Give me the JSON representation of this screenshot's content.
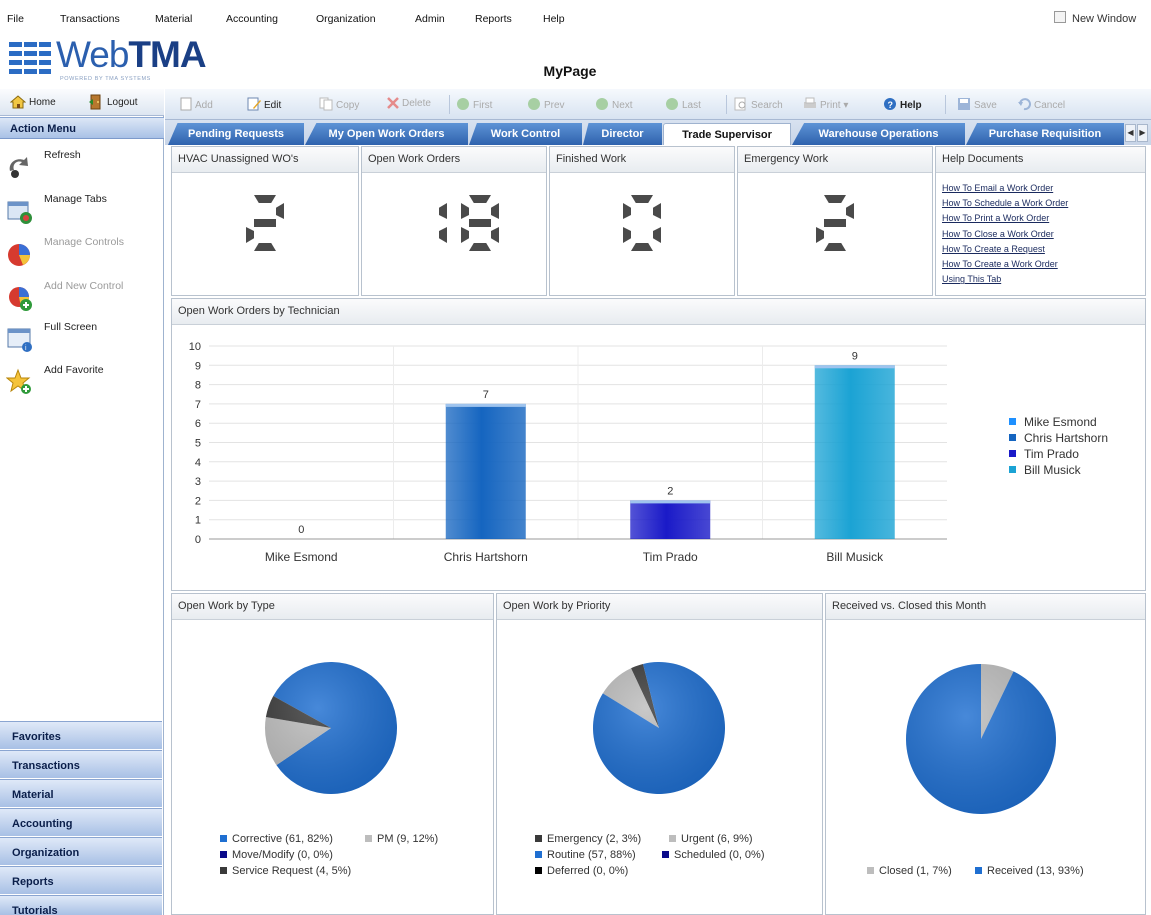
{
  "menu": [
    "File",
    "Transactions",
    "Material",
    "Accounting",
    "Organization",
    "Admin",
    "Reports",
    "Help"
  ],
  "new_window": "New Window",
  "logo": {
    "prefix": "Web",
    "bold": "TMA",
    "sub": "POWERED BY TMA SYSTEMS"
  },
  "page_title": "MyPage",
  "sidebar": {
    "home": "Home",
    "logout": "Logout",
    "action_menu": "Action Menu",
    "actions": [
      {
        "label": "Refresh",
        "icon": "refresh-icon",
        "enabled": true
      },
      {
        "label": "Manage Tabs",
        "icon": "manage-tabs-icon",
        "enabled": true
      },
      {
        "label": "Manage Controls",
        "icon": "manage-controls-icon",
        "enabled": false
      },
      {
        "label": "Add New Control",
        "icon": "add-control-icon",
        "enabled": false
      },
      {
        "label": "Full Screen",
        "icon": "full-screen-icon",
        "enabled": true
      },
      {
        "label": "Add Favorite",
        "icon": "add-favorite-icon",
        "enabled": true
      }
    ],
    "sections": [
      "Favorites",
      "Transactions",
      "Material",
      "Accounting",
      "Organization",
      "Reports",
      "Tutorials"
    ]
  },
  "toolbar": [
    {
      "label": "Add",
      "icon": "add-icon",
      "enabled": false
    },
    {
      "label": "Edit",
      "icon": "edit-icon",
      "enabled": true
    },
    {
      "label": "Copy",
      "icon": "copy-icon",
      "enabled": false
    },
    {
      "label": "Delete",
      "icon": "delete-icon",
      "enabled": false
    },
    {
      "label": "First",
      "icon": "first-icon",
      "enabled": false
    },
    {
      "label": "Prev",
      "icon": "prev-icon",
      "enabled": false
    },
    {
      "label": "Next",
      "icon": "next-icon",
      "enabled": false
    },
    {
      "label": "Last",
      "icon": "last-icon",
      "enabled": false
    },
    {
      "label": "Search",
      "icon": "search-icon",
      "enabled": false
    },
    {
      "label": "Print",
      "icon": "print-icon",
      "enabled": false
    },
    {
      "label": "Help",
      "icon": "help-icon",
      "enabled": true
    },
    {
      "label": "Save",
      "icon": "save-icon",
      "enabled": false
    },
    {
      "label": "Cancel",
      "icon": "cancel-icon",
      "enabled": false
    }
  ],
  "tabs": [
    {
      "label": "Pending Requests",
      "active": false
    },
    {
      "label": "My Open Work Orders",
      "active": false
    },
    {
      "label": "Work Control",
      "active": false
    },
    {
      "label": "Director",
      "active": false
    },
    {
      "label": "Trade Supervisor",
      "active": true
    },
    {
      "label": "Warehouse Operations",
      "active": false
    },
    {
      "label": "Purchase Requisition",
      "active": false
    }
  ],
  "counters": [
    {
      "title": "HVAC Unassigned WO's",
      "value": "2"
    },
    {
      "title": "Open Work Orders",
      "value": "18"
    },
    {
      "title": "Finished Work",
      "value": "0"
    },
    {
      "title": "Emergency Work",
      "value": "2"
    }
  ],
  "help_docs": {
    "title": "Help Documents",
    "links": [
      "How To Email a Work Order",
      "How To Schedule a Work Order",
      "How To Print a Work Order",
      "How To Close a Work Order",
      "How To Create a Request",
      "How To Create a Work Order",
      "Using This Tab"
    ]
  },
  "chart_data": [
    {
      "type": "bar",
      "title": "Open Work Orders by Technician",
      "categories": [
        "Mike Esmond",
        "Chris Hartshorn",
        "Tim Prado",
        "Bill Musick"
      ],
      "values": [
        0,
        7,
        2,
        9
      ],
      "colors": [
        "#1e90ff",
        "#1565c0",
        "#1a1ac8",
        "#1ba3d4"
      ],
      "ylim": [
        0,
        10
      ],
      "yticks": [
        0,
        1,
        2,
        3,
        4,
        5,
        6,
        7,
        8,
        9,
        10
      ],
      "grid": true,
      "legend": "right"
    },
    {
      "type": "pie",
      "title": "Open Work by Type",
      "slices": [
        {
          "label": "Corrective",
          "count": 61,
          "pct": 82,
          "color": "#1f6fd1"
        },
        {
          "label": "PM",
          "count": 9,
          "pct": 12,
          "color": "#bdbdbd"
        },
        {
          "label": "Move/Modify",
          "count": 0,
          "pct": 0,
          "color": "#0a0a8a"
        },
        {
          "label": "Service Request",
          "count": 4,
          "pct": 5,
          "color": "#3a3a3a"
        }
      ],
      "legend_text": [
        "Corrective (61, 82%)",
        "PM (9, 12%)",
        "Move/Modify (0, 0%)",
        "Service Request (4, 5%)"
      ]
    },
    {
      "type": "pie",
      "title": "Open Work by Priority",
      "slices": [
        {
          "label": "Emergency",
          "count": 2,
          "pct": 3,
          "color": "#3a3a3a"
        },
        {
          "label": "Urgent",
          "count": 6,
          "pct": 9,
          "color": "#bdbdbd"
        },
        {
          "label": "Routine",
          "count": 57,
          "pct": 88,
          "color": "#1f6fd1"
        },
        {
          "label": "Scheduled",
          "count": 0,
          "pct": 0,
          "color": "#0a0a8a"
        },
        {
          "label": "Deferred",
          "count": 0,
          "pct": 0,
          "color": "#000000"
        }
      ],
      "legend_text": [
        "Emergency (2, 3%)",
        "Urgent (6, 9%)",
        "Routine (57, 88%)",
        "Scheduled (0, 0%)",
        "Deferred (0, 0%)"
      ]
    },
    {
      "type": "pie",
      "title": "Received vs. Closed this Month",
      "slices": [
        {
          "label": "Closed",
          "count": 1,
          "pct": 7,
          "color": "#bdbdbd"
        },
        {
          "label": "Received",
          "count": 13,
          "pct": 93,
          "color": "#1f6fd1"
        }
      ],
      "legend_text": [
        "Closed (1, 7%)",
        "Received (13, 93%)"
      ]
    }
  ]
}
